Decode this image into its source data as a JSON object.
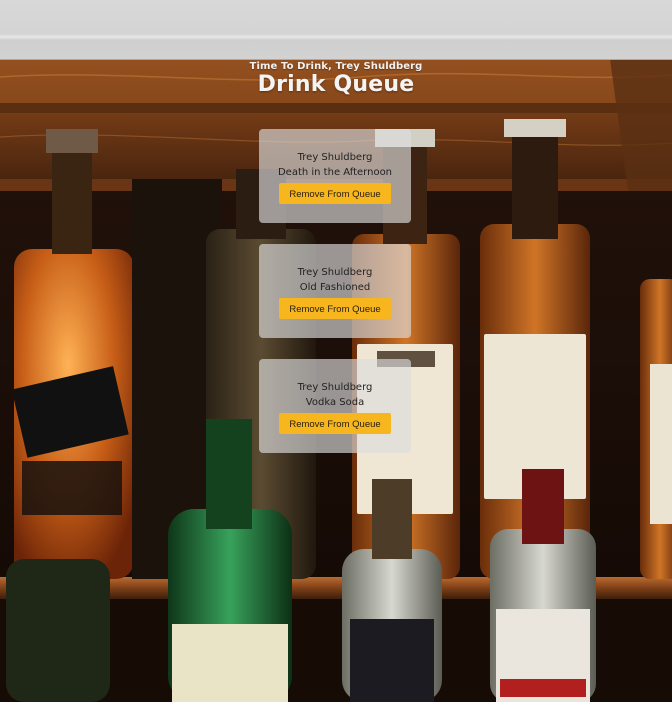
{
  "header": {
    "subtitle": "Time To Drink, Trey Shuldberg",
    "title": "Drink Queue"
  },
  "queue": [
    {
      "name": "Trey Shuldberg",
      "drink": "Death in the Afternoon",
      "button": "Remove From Queue"
    },
    {
      "name": "Trey Shuldberg",
      "drink": "Old Fashioned",
      "button": "Remove From Queue"
    },
    {
      "name": "Trey Shuldberg",
      "drink": "Vodka Soda",
      "button": "Remove From Queue"
    }
  ],
  "colors": {
    "button": "#f7b61e",
    "card": "#dcdcdc",
    "shelf_wood": "#8a4b21"
  },
  "icons": [
    "liquor-bottles-background"
  ]
}
